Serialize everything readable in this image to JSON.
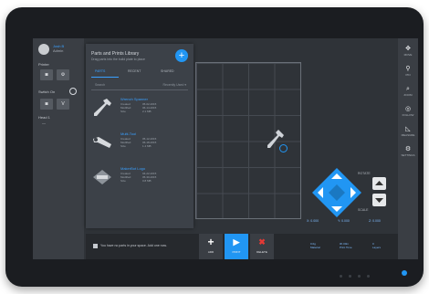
{
  "left": {
    "user_name": "Josh B",
    "user_sub": "Admin",
    "printer_label": "Printer",
    "btn1": "◙",
    "btn2": "⚙",
    "status_label": "Switch On",
    "btn3": "◙",
    "btn4": "V",
    "head_label": "Head 1",
    "head_val": "—"
  },
  "panel": {
    "title": "Parts and Prints Library",
    "subtitle": "Drag parts into the build plate to place",
    "add_glyph": "+",
    "tabs": [
      "PARTS",
      "RECENT",
      "SHARED"
    ],
    "search_placeholder": "Search",
    "sort_label": "Recently Used ▾",
    "items": [
      {
        "name": "Wrench Spanner",
        "meta_a": "Created\nModified\nSize",
        "meta_b": "05-02-2015\n06-14-2015\n2.1 MB"
      },
      {
        "name": "Multi-Tool",
        "meta_a": "Created\nModified\nSize",
        "meta_b": "05-12-2015\n06-18-2015\n1.4 MB"
      },
      {
        "name": "MakerBot Logo",
        "meta_a": "Created\nModified\nSize",
        "meta_b": "04-22-2015\n05-30-2015\n0.8 MB"
      }
    ]
  },
  "move": {
    "label_top": "ROTATE",
    "label_bottom": "SCALE",
    "x_label": "X: 0.000",
    "y_label": "Y: 0.000",
    "z_label": "Z: 0.000"
  },
  "toolbar": {
    "items": [
      {
        "glyph": "✥",
        "label": "MOVE"
      },
      {
        "glyph": "⚲",
        "label": "PIN"
      },
      {
        "glyph": "⌕",
        "label": "ZOOM"
      },
      {
        "glyph": "◎",
        "label": "FOLLOW"
      },
      {
        "glyph": "◺",
        "label": "MEASURE"
      },
      {
        "glyph": "⚙",
        "label": "SETTINGS"
      }
    ]
  },
  "bottom": {
    "message": "You have no parts in your space. Add one now.",
    "add_glyph": "+",
    "add_label": "ADD",
    "print_glyph": "▶",
    "print_label": "PRINT",
    "remove_glyph": "✖",
    "remove_label": "DELETE",
    "stat1": "0.0g\nMaterial",
    "stat2": "0h 00m\nPrint Time",
    "stat3": "0\nLayers"
  },
  "colors": {
    "accent": "#2196f3",
    "danger": "#c62828"
  }
}
